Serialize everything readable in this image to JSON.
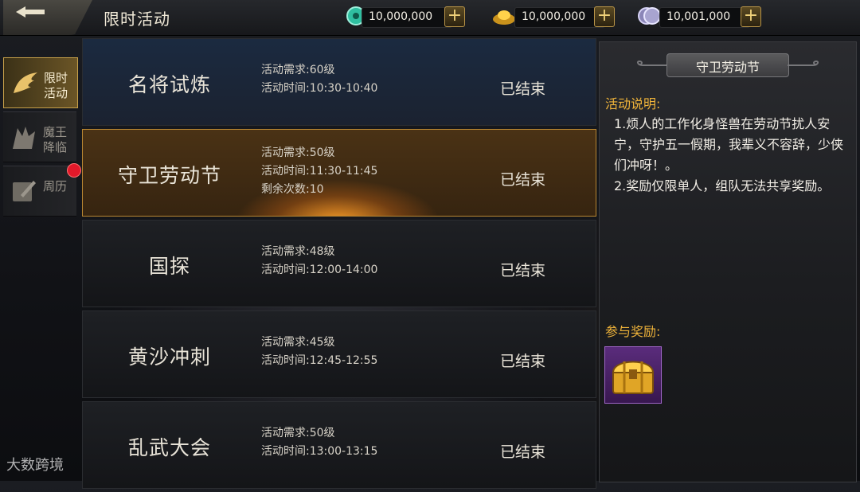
{
  "header": {
    "title": "限时活动",
    "currencies": [
      {
        "icon": "jade-icon",
        "value": "10,000,000"
      },
      {
        "icon": "gold-ingot-icon",
        "value": "10,000,000"
      },
      {
        "icon": "silver-coin-icon",
        "value": "10,001,000"
      }
    ],
    "plus_label": "+"
  },
  "nav": {
    "items": [
      {
        "label": "限时活动",
        "icon": "wing-icon",
        "active": true
      },
      {
        "label": "魔王降临",
        "icon": "demon-icon",
        "active": false
      },
      {
        "label": "周历",
        "icon": "calendar-icon",
        "active": false,
        "badge": true
      }
    ]
  },
  "events": [
    {
      "name": "名将试炼",
      "lines": [
        "活动需求:60级",
        "活动时间:10:30-10:40"
      ],
      "status": "已结束"
    },
    {
      "name": "守卫劳动节",
      "lines": [
        "活动需求:50级",
        "活动时间:11:30-11:45",
        "剩余次数:10"
      ],
      "status": "已结束"
    },
    {
      "name": "国探",
      "lines": [
        "活动需求:48级",
        "活动时间:12:00-14:00"
      ],
      "status": "已结束"
    },
    {
      "name": "黄沙冲刺",
      "lines": [
        "活动需求:45级",
        "活动时间:12:45-12:55"
      ],
      "status": "已结束"
    },
    {
      "name": "乱武大会",
      "lines": [
        "活动需求:50级",
        "活动时间:13:00-13:15"
      ],
      "status": "已结束"
    }
  ],
  "detail": {
    "title": "守卫劳动节",
    "desc_label": "活动说明:",
    "desc_text": "1.烦人的工作化身怪兽在劳动节扰人安宁，守护五一假期，我辈义不容辞，少侠们冲呀！。\n2.奖励仅限单人，组队无法共享奖励。",
    "reward_label": "参与奖励:",
    "reward_item": "gold-chest-icon"
  },
  "watermark": "大数跨境",
  "colors": {
    "accent_gold": "#f0b43a",
    "active_border": "#c6a04a",
    "badge_red": "#e2192a",
    "reward_purple": "#5a2c7c"
  }
}
